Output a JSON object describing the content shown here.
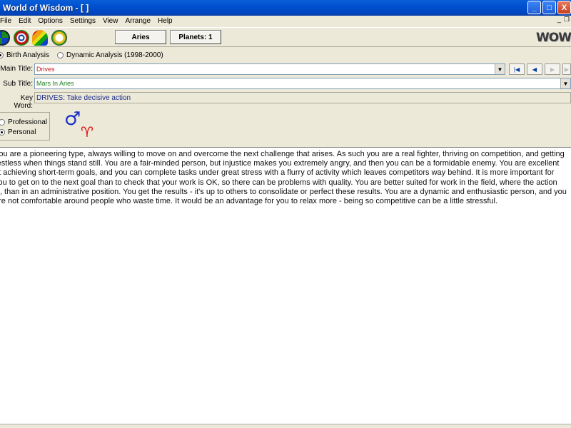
{
  "window": {
    "title": "World of Wisdom - [ ]",
    "controls": {
      "minimize": "_",
      "maximize": "□",
      "close": "X"
    }
  },
  "menu": {
    "items": [
      "File",
      "Edit",
      "Options",
      "Settings",
      "View",
      "Arrange",
      "Help"
    ],
    "mdi_controls": {
      "minimize": "_",
      "restore": "❐"
    }
  },
  "toolbar": {
    "icons": [
      "chart-wheel-icon",
      "target-icon",
      "rainbow-icon",
      "clock-icon"
    ],
    "sign_button": "Aries",
    "planets_button": "Planets: 1",
    "logo": "WOW"
  },
  "analysis": {
    "birth_label": "Birth Analysis",
    "dynamic_label": "Dynamic Analysis (1998-2000)",
    "selected": "birth"
  },
  "fields": {
    "main_title_label": "Main Title:",
    "main_title_value": "Drives",
    "sub_title_label": "Sub Title:",
    "sub_title_value": "Mars In Aries",
    "key_word_label": "Key Word:",
    "key_word_value": "DRIVES: Take decisive action"
  },
  "mode": {
    "professional_label": "Professional",
    "personal_label": "Personal",
    "selected": "personal"
  },
  "symbols": {
    "planet": "♂",
    "sign": "♈"
  },
  "colors": {
    "mars": "#1a2fc8",
    "aries": "#e01010",
    "main_title_text": "#c02020",
    "sub_title_text": "#208020",
    "key_word_text": "#1a2a8a"
  },
  "text": {
    "body": "You are a pioneering type, always willing to move on and overcome the next challenge that arises. As such you are a real fighter, thriving on competition, and getting restless when things stand still. You are a fair-minded person, but injustice makes you extremely angry, and then you can be a formidable enemy. You are excellent at achieving short-term goals, and you can complete tasks under great stress with a flurry of activity which leaves competitors way behind. It is more important for you to get on to the next goal than to check that your work is OK, so there can be problems with quality. You are better suited for work in the field, where the action is, than in an administrative position. You get the results - it's up to others to consolidate or perfect these results. You are a dynamic and enthusiastic person, and you are not comfortable around people who waste time. It would be an advantage for you to relax more - being so competitive can be a little stressful."
  }
}
